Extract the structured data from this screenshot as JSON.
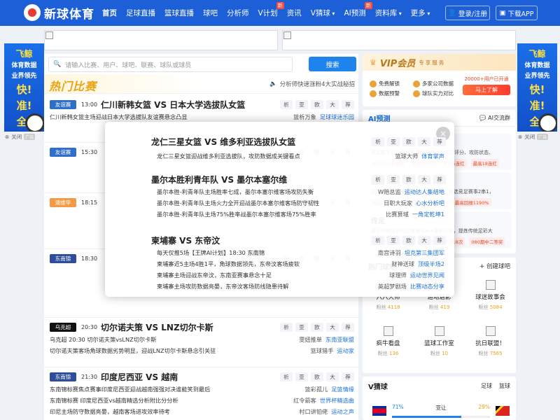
{
  "nav": {
    "logo": "新球体育",
    "items": [
      {
        "label": "首页",
        "active": true,
        "badge": "",
        "caret": false
      },
      {
        "label": "足球直播",
        "active": false,
        "badge": "",
        "caret": false
      },
      {
        "label": "篮球直播",
        "active": false,
        "badge": "",
        "caret": false
      },
      {
        "label": "球吧",
        "active": false,
        "badge": "",
        "caret": false
      },
      {
        "label": "分析师",
        "active": false,
        "badge": "",
        "caret": false
      },
      {
        "label": "V计划",
        "active": false,
        "badge": "新",
        "caret": false
      },
      {
        "label": "资讯",
        "active": false,
        "badge": "",
        "caret": false
      },
      {
        "label": "V猜球",
        "active": false,
        "badge": "",
        "caret": true
      },
      {
        "label": "AI预测",
        "active": false,
        "badge": "新",
        "caret": false
      },
      {
        "label": "资料库",
        "active": false,
        "badge": "",
        "caret": true
      },
      {
        "label": "更多",
        "active": false,
        "badge": "",
        "caret": true
      }
    ],
    "login": "登录/注册",
    "download": "下载APP"
  },
  "side_ad": {
    "t1": "飞鲸",
    "t2a": "体育数据",
    "t2b": "业界领先",
    "t3a": "快!",
    "t3b": "准!",
    "t3c": "全!",
    "close": "关闭",
    "close_tag": "广告"
  },
  "search": {
    "placeholder": "请输入比赛、用户、球吧、联赛、球队或球员",
    "button": "搜索"
  },
  "hot": {
    "title": "热门比赛",
    "notice": "分析师快速涨粉4大实战秘招"
  },
  "tab_labels": [
    "析",
    "亚",
    "欧",
    "大",
    "荐"
  ],
  "matches": [
    {
      "league": "友谊赛",
      "league_color": "#2f6fc9",
      "time": "13:00",
      "title": "仁川新韩女篮 VS 日本大学选拔队女篮",
      "lines": [
        {
          "text": "仁川新韩女篮主场迎战日本大学选拔队友谊赛悬念凸显",
          "author": "篮析万象",
          "tag": "足球球迷乐园"
        }
      ]
    },
    {
      "league": "友谊赛",
      "league_color": "#2f6fc9",
      "time": "15:30",
      "title": "",
      "lines": []
    },
    {
      "league": "澳维甲",
      "league_color": "#f29a45",
      "time": "18:15",
      "title": "",
      "lines": []
    },
    {
      "league": "东南锦",
      "league_color": "#2e4d9a",
      "time": "18:30",
      "title": "",
      "lines": []
    },
    {
      "league": "乌克超",
      "league_color": "#111111",
      "time": "20:30",
      "title": "切尔诺夫策 VS LNZ切尔卡斯",
      "lines": [
        {
          "text": "乌克超 20:30 切尔诺夫策vsLNZ切尔卡斯",
          "author": "雯妞推单",
          "tag": "东南亚联盟"
        },
        {
          "text": "切尔诺夫策客场角球数据劣势明显，迎战LNZ切尔卡斯悬念引关驻",
          "author": "篮球猎手",
          "tag": "运动家"
        }
      ]
    },
    {
      "league": "东南锦",
      "league_color": "#2e4d9a",
      "time": "21:30",
      "title": "印度尼西亚 VS 越南",
      "lines": [
        {
          "text": "东南锦标赛焦点赛事印度尼西亚迎战越南强强对决谁能笑到最后",
          "author": "篮彩孤儿",
          "tag": "足篮情缘"
        },
        {
          "text": "东南锦标赛 印度尼西亚vs越南精选分析附比分分析",
          "author": "红令箭客",
          "tag": "世界杯精选曲"
        },
        {
          "text": "印尼主场防守数据亮晏，越南客场进攻效率待考",
          "author": "村口讲铂佬",
          "tag": "运动之声"
        }
      ]
    }
  ],
  "modal": {
    "close": "×",
    "blocks": [
      {
        "title": "龙仁三星女篮 VS 维多利亚选拔队女篮",
        "lines": [
          {
            "text": "龙仁三星女篮迎战维多利亚选拔队，攻防数据成关键看点",
            "author": "篮球大师",
            "tag": "体育掌声"
          }
        ]
      },
      {
        "title": "墨尔本胜利青年队 VS 墨尔本塞尔维",
        "lines": [
          {
            "text": "墨尔本胜-利青年队主场胜率七成，墨尔本塞尔维客场攻防失衡",
            "author": "W赔总监",
            "tag": "运动达人集结地"
          },
          {
            "text": "墨尔本胜-利青年队主场火力全开迎战墨尔本塞尔维客场防守韧性",
            "author": "日职大玩家",
            "tag": "心水分析吧"
          },
          {
            "text": "墨尔本胜-利青年队主场75%胜率战墨尔本塞尔维客场75%胜率",
            "author": "比赛算域",
            "tag": "一角定乾坤1"
          }
        ]
      },
      {
        "title": "柬埔寨 VS 东帝汶",
        "lines": [
          {
            "text": "每天仅推5场【王牌AI计划】18:30 东南锦",
            "author": "南宫诗羽",
            "tag": "坦克第三集团军"
          },
          {
            "text": "柬埔寨近5主场4胜1平，角球数据领先，东帝汶客场疲软",
            "author": "财神送球",
            "tag": "顶级半场2"
          },
          {
            "text": "柬埔寨主场迎战东帝汶，东南亚赛事悬念十足",
            "author": "球理师",
            "tag": "运动世界见闻"
          },
          {
            "text": "柬埔寨主场攻防数据亮晏，东帝汶客场防线隐患待解",
            "author": "英超梦剧场",
            "tag": "比赛动态分享"
          }
        ]
      }
    ]
  },
  "vip": {
    "title": "VIP会员",
    "subtitle": "专享服务",
    "features": [
      "免费解锁",
      "多家公司数据",
      "数据预警",
      "球队实力对比"
    ],
    "users": "20000+用户已开通",
    "join": "马上了解"
  },
  "ai": {
    "title": "AI预测",
    "link": "AI交流群",
    "cards": [
      {
        "name": "竞足",
        "desc": "竞足胜平负及进球数量化预测，含实力评分、攻防状态、",
        "tags": [
          "6月72%命中率",
          "胜6跃7停4",
          "昇超5连红",
          "最高18连红"
        ]
      },
      {
        "name": "组合",
        "desc": "通过AI+数据量化评分与概率换算，精选竞足赛事2串1，",
        "tags": [
          "竞足2串1",
          "昨天命中两组方案",
          "单日最高回报1190%"
        ]
      },
      {
        "name": "传足",
        "desc": "基于传统足彩历史数据与AI+量化分析，提炼传统足彩大",
        "tags": [
          "历史命中一等奖1次",
          "历史命中二等奖18次",
          "080期中二等奖"
        ]
      }
    ]
  },
  "bars": {
    "title": "热门球吧",
    "create": "+ 创建球吧",
    "fans_label": "粉丝",
    "items": [
      {
        "name": "六六大师",
        "fans": "4118"
      },
      {
        "name": "运动魅影",
        "fans": "419"
      },
      {
        "name": "球迷故事会",
        "fans": "5084"
      },
      {
        "name": "疯牛看盘",
        "fans": "136"
      },
      {
        "name": "篮球工作室",
        "fans": "10"
      },
      {
        "name": "抗日联盟！",
        "fans": "7565"
      }
    ]
  },
  "vguess": {
    "title": "V猜球",
    "tabs": [
      "足球",
      "篮球"
    ],
    "left_pct": "71%",
    "middle": "亚让",
    "right_pct": "29%",
    "left_share": 0.71
  }
}
